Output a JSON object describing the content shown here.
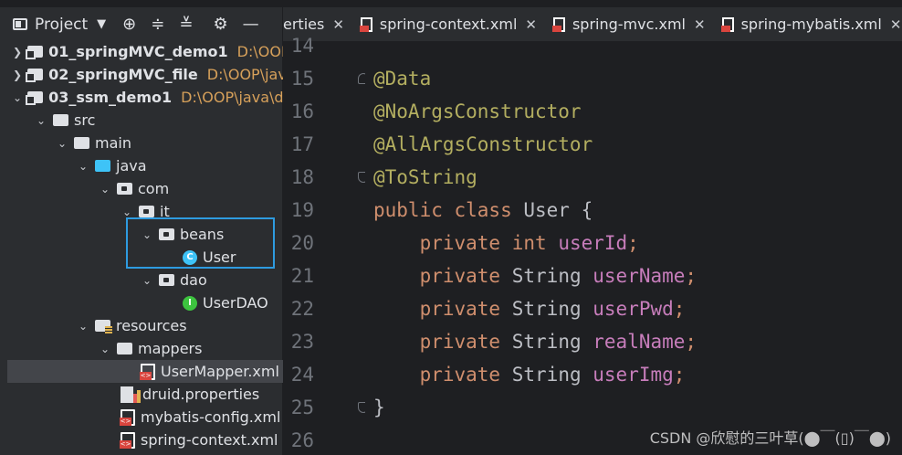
{
  "project_panel": {
    "title": "Project",
    "tree": [
      {
        "label": "01_springMVC_demo1",
        "path": "D:\\OOP",
        "bold": true
      },
      {
        "label": "02_springMVC_file",
        "path": "D:\\OOP\\java",
        "bold": true
      },
      {
        "label": "03_ssm_demo1",
        "path": "D:\\OOP\\java\\de",
        "bold": true
      },
      {
        "label": "src"
      },
      {
        "label": "main"
      },
      {
        "label": "java"
      },
      {
        "label": "com"
      },
      {
        "label": "it"
      },
      {
        "label": "beans"
      },
      {
        "label": "User"
      },
      {
        "label": "dao"
      },
      {
        "label": "UserDAO"
      },
      {
        "label": "resources"
      },
      {
        "label": "mappers"
      },
      {
        "label": "UserMapper.xml"
      },
      {
        "label": "druid.properties"
      },
      {
        "label": "mybatis-config.xml"
      },
      {
        "label": "spring-context.xml"
      }
    ]
  },
  "tabs": [
    {
      "label": "erties"
    },
    {
      "label": "spring-context.xml"
    },
    {
      "label": "spring-mvc.xml"
    },
    {
      "label": "spring-mybatis.xml"
    }
  ],
  "editor": {
    "line_numbers": [
      "14",
      "15",
      "16",
      "17",
      "18",
      "19",
      "20",
      "21",
      "22",
      "23",
      "24",
      "25",
      "26"
    ],
    "lines": {
      "l15": "@Data",
      "l16": "@NoArgsConstructor",
      "l17": "@AllArgsConstructor",
      "l18": "@ToString",
      "l19_kw": "public class",
      "l19_name": "User {",
      "l20_kw": "private int",
      "l20_fld": "userId",
      "l21_kw": "private",
      "l21_type": "String",
      "l21_fld": "userName",
      "l22_kw": "private",
      "l22_type": "String",
      "l22_fld": "userPwd",
      "l23_kw": "private",
      "l23_type": "String",
      "l23_fld": "realName",
      "l24_kw": "private",
      "l24_type": "String",
      "l24_fld": "userImg",
      "semicolon": ";",
      "l25": "}"
    }
  },
  "watermark": "CSDN @欣慰的三叶草(⬤￣(▯)￣⬤)",
  "colors": {
    "annotation": "#b3ae60",
    "keyword": "#cf8e6d",
    "field": "#c77dbb",
    "highlight_box": "#2e9be0"
  }
}
